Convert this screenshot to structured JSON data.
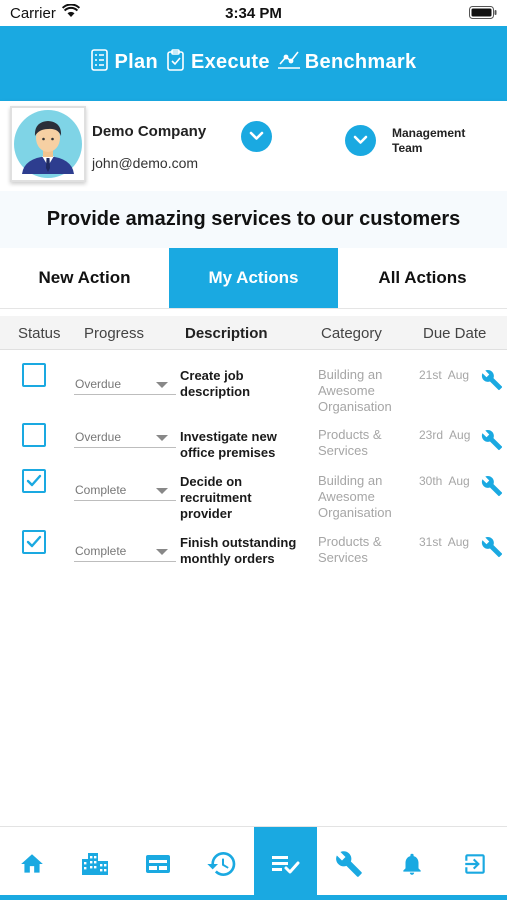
{
  "status_bar": {
    "carrier": "Carrier",
    "time": "3:34 PM"
  },
  "header": {
    "brand": [
      "Plan",
      "Execute",
      "Benchmark"
    ]
  },
  "profile": {
    "company": "Demo Company",
    "email": "john@demo.com",
    "team": "Management Team"
  },
  "mission": "Provide amazing services to our customers",
  "tabs": [
    {
      "label": "New Action",
      "active": false
    },
    {
      "label": "My Actions",
      "active": true
    },
    {
      "label": "All Actions",
      "active": false
    }
  ],
  "columns": {
    "status": "Status",
    "progress": "Progress",
    "description": "Description",
    "category": "Category",
    "due_date": "Due Date"
  },
  "actions": [
    {
      "checked": false,
      "progress": "Overdue",
      "description": "Create job description",
      "category": "Building an Awesome Organisation",
      "due_day": "21st",
      "due_month": "Aug"
    },
    {
      "checked": false,
      "progress": "Overdue",
      "description": "Investigate new office premises",
      "category": "Products & Services",
      "due_day": "23rd",
      "due_month": "Aug"
    },
    {
      "checked": true,
      "progress": "Complete",
      "description": "Decide on recruitment provider",
      "category": "Building an Awesome Organisation",
      "due_day": "30th",
      "due_month": "Aug"
    },
    {
      "checked": true,
      "progress": "Complete",
      "description": "Finish outstanding monthly orders",
      "category": "Products & Services",
      "due_day": "31st",
      "due_month": "Aug"
    }
  ],
  "bottom_nav": [
    {
      "icon": "home-icon",
      "active": false
    },
    {
      "icon": "building-icon",
      "active": false
    },
    {
      "icon": "card-icon",
      "active": false
    },
    {
      "icon": "history-icon",
      "active": false
    },
    {
      "icon": "checklist-icon",
      "active": true
    },
    {
      "icon": "wrench-icon",
      "active": false
    },
    {
      "icon": "bell-icon",
      "active": false
    },
    {
      "icon": "logout-icon",
      "active": false
    }
  ],
  "colors": {
    "accent": "#1aa9e1",
    "muted_text": "#a6a6a6"
  }
}
